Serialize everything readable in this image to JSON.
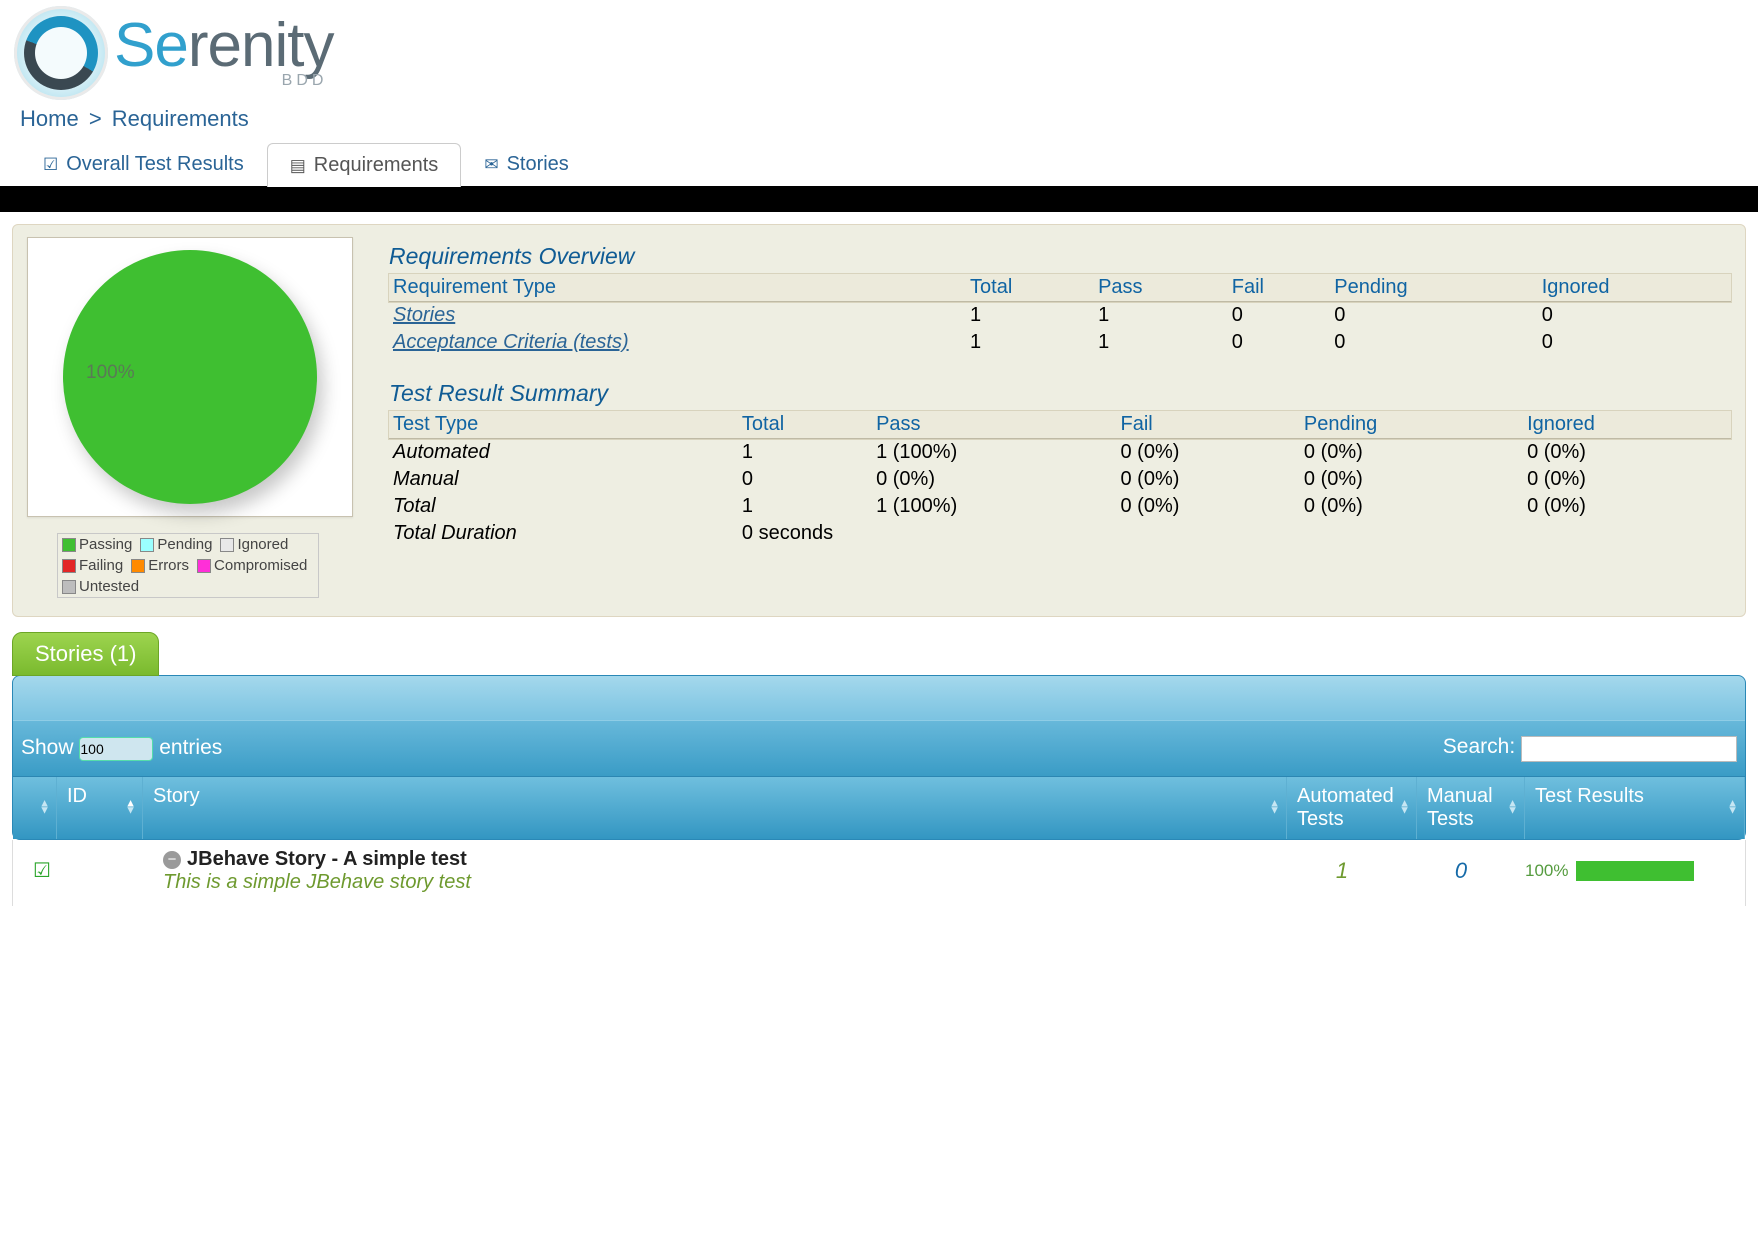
{
  "brand": {
    "name_pre": "Se",
    "name_post": "renity",
    "sub": "BDD"
  },
  "breadcrumb": {
    "home": "Home",
    "sep": ">",
    "current": "Requirements"
  },
  "tabs": {
    "overall": "Overall Test Results",
    "requirements": "Requirements",
    "stories": "Stories"
  },
  "chart_data": {
    "type": "pie",
    "title": "",
    "slices": [
      {
        "name": "Passing",
        "value": 100,
        "color": "#3fbf31"
      }
    ],
    "center_label": "100%"
  },
  "legend": {
    "passing": "Passing",
    "pending": "Pending",
    "ignored": "Ignored",
    "failing": "Failing",
    "errors": "Errors",
    "compromised": "Compromised",
    "untested": "Untested"
  },
  "requirements_overview": {
    "title": "Requirements Overview",
    "headers": {
      "type": "Requirement Type",
      "total": "Total",
      "pass": "Pass",
      "fail": "Fail",
      "pending": "Pending",
      "ignored": "Ignored"
    },
    "rows": [
      {
        "type": "Stories",
        "total": "1",
        "pass": "1",
        "fail": "0",
        "pending": "0",
        "ignored": "0"
      },
      {
        "type": "Acceptance Criteria (tests)",
        "total": "1",
        "pass": "1",
        "fail": "0",
        "pending": "0",
        "ignored": "0"
      }
    ]
  },
  "test_summary": {
    "title": "Test Result Summary",
    "headers": {
      "type": "Test Type",
      "total": "Total",
      "pass": "Pass",
      "fail": "Fail",
      "pending": "Pending",
      "ignored": "Ignored"
    },
    "rows": [
      {
        "type": "Automated",
        "total": "1",
        "pass": "1 (100%)",
        "fail": "0 (0%)",
        "pending": "0 (0%)",
        "ignored": "0 (0%)"
      },
      {
        "type": "Manual",
        "total": "0",
        "pass": "0 (0%)",
        "fail": "0 (0%)",
        "pending": "0 (0%)",
        "ignored": "0 (0%)"
      },
      {
        "type": "Total",
        "total": "1",
        "pass": "1 (100%)",
        "fail": "0 (0%)",
        "pending": "0 (0%)",
        "ignored": "0 (0%)"
      }
    ],
    "duration_label": "Total Duration",
    "duration_value": "0 seconds"
  },
  "stories_panel": {
    "tab_label": "Stories (1)",
    "show_label": "Show",
    "entries_label": "entries",
    "page_size": "100",
    "search_label": "Search:",
    "headers": {
      "id": "ID",
      "story": "Story",
      "automated": "Automated Tests",
      "manual": "Manual Tests",
      "results": "Test Results"
    },
    "row": {
      "title": "JBehave Story - A simple test",
      "desc": "This is a simple JBehave story test",
      "automated": "1",
      "manual": "0",
      "result_pct": "100%"
    }
  }
}
